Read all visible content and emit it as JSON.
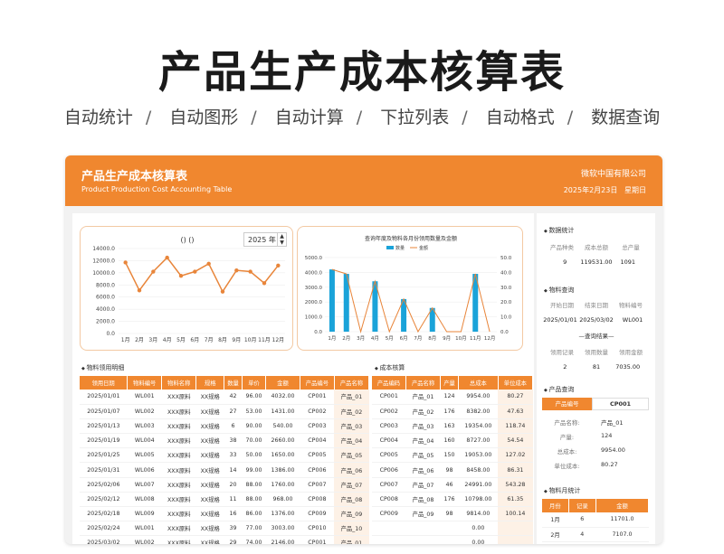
{
  "hero": {
    "title": "产品生产成本核算表",
    "features": [
      "自动统计",
      "自动图形",
      "自动计算",
      "下拉列表",
      "自动格式",
      "数据查询"
    ]
  },
  "header": {
    "title_cn": "产品生产成本核算表",
    "title_en": "Product Production Cost Accounting Table",
    "company": "微软中国有限公司",
    "date": "2025年2月23日",
    "weekday": "星期日"
  },
  "colors": {
    "accent": "#f0872f",
    "bar": "#1aa3d9",
    "line": "#e8853a"
  },
  "chart1": {
    "title": "()   ()",
    "year_value": "2025 年"
  },
  "chart2": {
    "title": "查询年度及物料各月份领用数量及金额",
    "legend": [
      "数量",
      "金额"
    ]
  },
  "chart_data": [
    {
      "type": "line",
      "title": "()   ()",
      "categories": [
        "1月",
        "2月",
        "3月",
        "4月",
        "5月",
        "6月",
        "7月",
        "8月",
        "9月",
        "10月",
        "11月",
        "12月"
      ],
      "values": [
        11700,
        7100,
        10200,
        12500,
        9500,
        10200,
        11500,
        6900,
        10400,
        10200,
        8300,
        11200
      ],
      "ylim": [
        0,
        14000
      ],
      "yticks": [
        "0.0",
        "2000.0",
        "4000.0",
        "6000.0",
        "8000.0",
        "10000.0",
        "12000.0",
        "14000.0"
      ]
    },
    {
      "type": "bar",
      "title": "查询年度及物料各月份领用数量及金额",
      "categories": [
        "1月",
        "2月",
        "3月",
        "4月",
        "5月",
        "6月",
        "7月",
        "8月",
        "9月",
        "10月",
        "11月",
        "12月"
      ],
      "series": [
        {
          "name": "数量",
          "axis": "left",
          "values": [
            4200,
            3900,
            0,
            3400,
            0,
            2200,
            0,
            1600,
            0,
            0,
            3900,
            0
          ]
        },
        {
          "name": "金额",
          "axis": "right",
          "values": [
            42,
            39,
            0,
            34,
            0,
            22,
            0,
            16,
            0,
            0,
            39,
            0
          ]
        }
      ],
      "ylim_left": [
        0,
        5000
      ],
      "ylim_right": [
        0,
        50
      ],
      "yticks_left": [
        "0.0",
        "1000.0",
        "2000.0",
        "3000.0",
        "4000.0",
        "5000.0"
      ],
      "yticks_right": [
        "0.0",
        "10.0",
        "20.0",
        "30.0",
        "40.0",
        "50.0"
      ]
    }
  ],
  "usage_table": {
    "section": "物料领用明细",
    "columns": [
      "领用日期",
      "物料编号",
      "物料名称",
      "规格",
      "数量",
      "单价",
      "金额",
      "产品编号",
      "产品名称"
    ],
    "rows": [
      [
        "2025/01/01",
        "WL001",
        "XXX原料",
        "XX规格",
        "42",
        "96.00",
        "4032.00",
        "CP001",
        "产品_01"
      ],
      [
        "2025/01/07",
        "WL002",
        "XXX原料",
        "XX规格",
        "27",
        "53.00",
        "1431.00",
        "CP002",
        "产品_02"
      ],
      [
        "2025/01/13",
        "WL003",
        "XXX原料",
        "XX规格",
        "6",
        "90.00",
        "540.00",
        "CP003",
        "产品_03"
      ],
      [
        "2025/01/19",
        "WL004",
        "XXX原料",
        "XX规格",
        "38",
        "70.00",
        "2660.00",
        "CP004",
        "产品_04"
      ],
      [
        "2025/01/25",
        "WL005",
        "XXX原料",
        "XX规格",
        "33",
        "50.00",
        "1650.00",
        "CP005",
        "产品_05"
      ],
      [
        "2025/01/31",
        "WL006",
        "XXX原料",
        "XX规格",
        "14",
        "99.00",
        "1386.00",
        "CP006",
        "产品_06"
      ],
      [
        "2025/02/06",
        "WL007",
        "XXX原料",
        "XX规格",
        "20",
        "88.00",
        "1760.00",
        "CP007",
        "产品_07"
      ],
      [
        "2025/02/12",
        "WL008",
        "XXX原料",
        "XX规格",
        "11",
        "88.00",
        "968.00",
        "CP008",
        "产品_08"
      ],
      [
        "2025/02/18",
        "WL009",
        "XXX原料",
        "XX规格",
        "16",
        "86.00",
        "1376.00",
        "CP009",
        "产品_09"
      ],
      [
        "2025/02/24",
        "WL001",
        "XXX原料",
        "XX规格",
        "39",
        "77.00",
        "3003.00",
        "CP010",
        "产品_10"
      ],
      [
        "2025/03/02",
        "WL002",
        "XXX原料",
        "XX规格",
        "29",
        "74.00",
        "2146.00",
        "CP001",
        "产品_01"
      ]
    ]
  },
  "cost_table": {
    "section": "成本核算",
    "columns": [
      "产品编码",
      "产品名称",
      "产量",
      "总成本",
      "单位成本"
    ],
    "rows": [
      [
        "CP001",
        "产品_01",
        "124",
        "9954.00",
        "80.27"
      ],
      [
        "CP002",
        "产品_02",
        "176",
        "8382.00",
        "47.63"
      ],
      [
        "CP003",
        "产品_03",
        "163",
        "19354.00",
        "118.74"
      ],
      [
        "CP004",
        "产品_04",
        "160",
        "8727.00",
        "54.54"
      ],
      [
        "CP005",
        "产品_05",
        "150",
        "19053.00",
        "127.02"
      ],
      [
        "CP006",
        "产品_06",
        "98",
        "8458.00",
        "86.31"
      ],
      [
        "CP007",
        "产品_07",
        "46",
        "24991.00",
        "543.28"
      ],
      [
        "CP008",
        "产品_08",
        "176",
        "10798.00",
        "61.35"
      ],
      [
        "CP009",
        "产品_09",
        "98",
        "9814.00",
        "100.14"
      ],
      [
        "",
        "",
        "",
        "0.00",
        ""
      ],
      [
        "",
        "",
        "",
        "0.00",
        ""
      ]
    ]
  },
  "side": {
    "stats": {
      "section": "数据统计",
      "labels": [
        "产品种类",
        "成本总额",
        "总产量"
      ],
      "values": [
        "9",
        "119531.00",
        "1091"
      ]
    },
    "material_query": {
      "section": "物料查询",
      "labels": [
        "开始日期",
        "结束日期",
        "物料编号"
      ],
      "values": [
        "2025/01/01",
        "2025/03/02",
        "WL001"
      ],
      "result_title": "—查询结果—",
      "result_labels": [
        "领用记录",
        "领用数量",
        "领用金额"
      ],
      "result_values": [
        "2",
        "81",
        "7035.00"
      ]
    },
    "product_query": {
      "section": "产品查询",
      "key_label": "产品编号",
      "key_value": "CP001",
      "rows": [
        {
          "k": "产品名称:",
          "v": "产品_01"
        },
        {
          "k": "产量:",
          "v": "124"
        },
        {
          "k": "总成本:",
          "v": "9954.00"
        },
        {
          "k": "单位成本:",
          "v": "80.27"
        }
      ]
    },
    "monthly": {
      "section": "物料月统计",
      "columns": [
        "月份",
        "记录",
        "金额"
      ],
      "rows": [
        [
          "1月",
          "6",
          "11701.0"
        ],
        [
          "2月",
          "4",
          "7107.0"
        ]
      ]
    }
  }
}
